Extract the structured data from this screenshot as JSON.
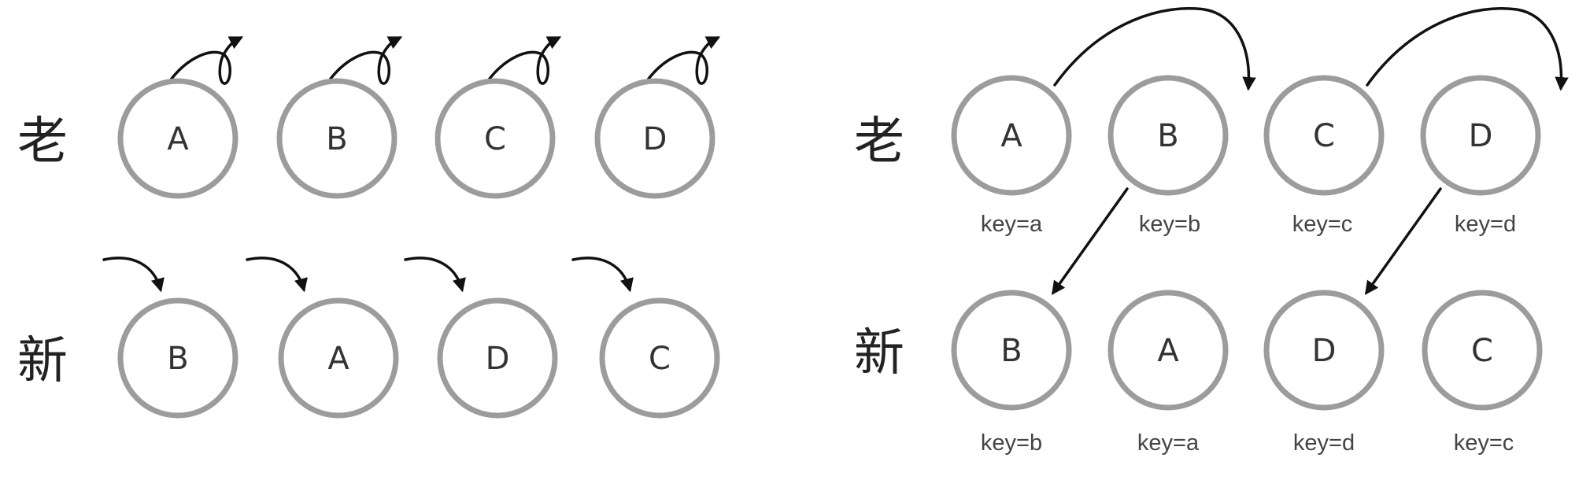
{
  "left_panel": {
    "old_label": "老",
    "new_label": "新",
    "old_nodes": [
      "A",
      "B",
      "C",
      "D"
    ],
    "new_nodes": [
      "B",
      "A",
      "D",
      "C"
    ]
  },
  "right_panel": {
    "old_label": "老",
    "new_label": "新",
    "old_nodes": [
      {
        "letter": "A",
        "key": "key=a"
      },
      {
        "letter": "B",
        "key": "key=b"
      },
      {
        "letter": "C",
        "key": "key=c"
      },
      {
        "letter": "D",
        "key": "key=d"
      }
    ],
    "new_nodes": [
      {
        "letter": "B",
        "key": "key=b"
      },
      {
        "letter": "A",
        "key": "key=a"
      },
      {
        "letter": "D",
        "key": "key=d"
      },
      {
        "letter": "C",
        "key": "key=c"
      }
    ]
  },
  "colors": {
    "circle_stroke": "#9c9c9c",
    "arrow": "#111111",
    "text": "#333333"
  }
}
